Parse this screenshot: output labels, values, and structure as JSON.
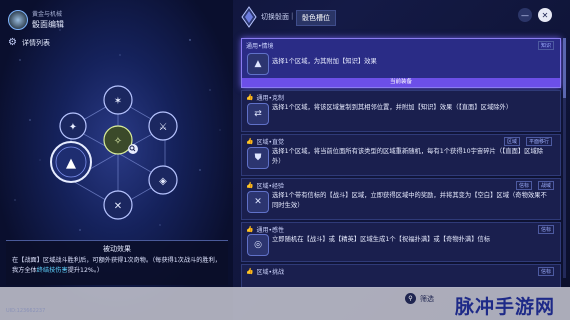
{
  "header": {
    "title_small": "黄金与机械",
    "title": "骰面编辑",
    "detail_list": "详情列表"
  },
  "center_icon": "search-icon",
  "effect": {
    "title": "被动效果",
    "text_before": "在【战面】区域战斗胜利后，可额外获得1次奇物。（每获得1次战斗的胜利，我方全体",
    "text_highlight": "终结技伤害",
    "text_after": "提升12%。）"
  },
  "uid": "UID:123662237",
  "tabs": {
    "switch": "切换骰面",
    "sep": "|",
    "current": "骰色槽位"
  },
  "cards": [
    {
      "head": "通用•情境",
      "tag": "知识",
      "text": "选择1个区域，为其附加【知识】效果",
      "equipped": "当前装备",
      "icon": "triangle-icon"
    },
    {
      "head": "通用•克制",
      "tag": "",
      "text_a": "选择1个区域，将该区域复制到其相邻位置，并附加【知识】效果（【直面】区域除外）",
      "icon": "arrows-icon"
    },
    {
      "head": "区域•直觉",
      "tag": "区域",
      "tag2": "平面移行",
      "text": "选择1个区域，将当前位面所有该类型的区域重新随机，每有1个获得10宇宙碎片（【直面】区域除外）",
      "icon": "shield-icon"
    },
    {
      "head": "区域•经验",
      "tag": "信标",
      "tag2": "战域",
      "text": "选择1个带有信标的【战斗】区域，立即获得区域中的奖励，并将其变为【空白】区域（奇物效果不同时生效）",
      "icon": "cross-icon"
    },
    {
      "head": "通用•感性",
      "tag": "",
      "tag2": "信标",
      "text": "立即随机在【战斗】或【精英】区域生成1个【祝福扑满】或【奇物扑满】信标",
      "icon": "coin-icon"
    },
    {
      "head": "区域•挑战",
      "tag": "",
      "tag2": "信标",
      "text": "",
      "icon": "star-icon"
    }
  ],
  "bottom": {
    "filter": "筛选",
    "watermark": "脉冲手游网"
  },
  "colors": {
    "accent": "#6c4fe8",
    "highlight": "#60d4ff",
    "card": "#1a1f4e"
  }
}
